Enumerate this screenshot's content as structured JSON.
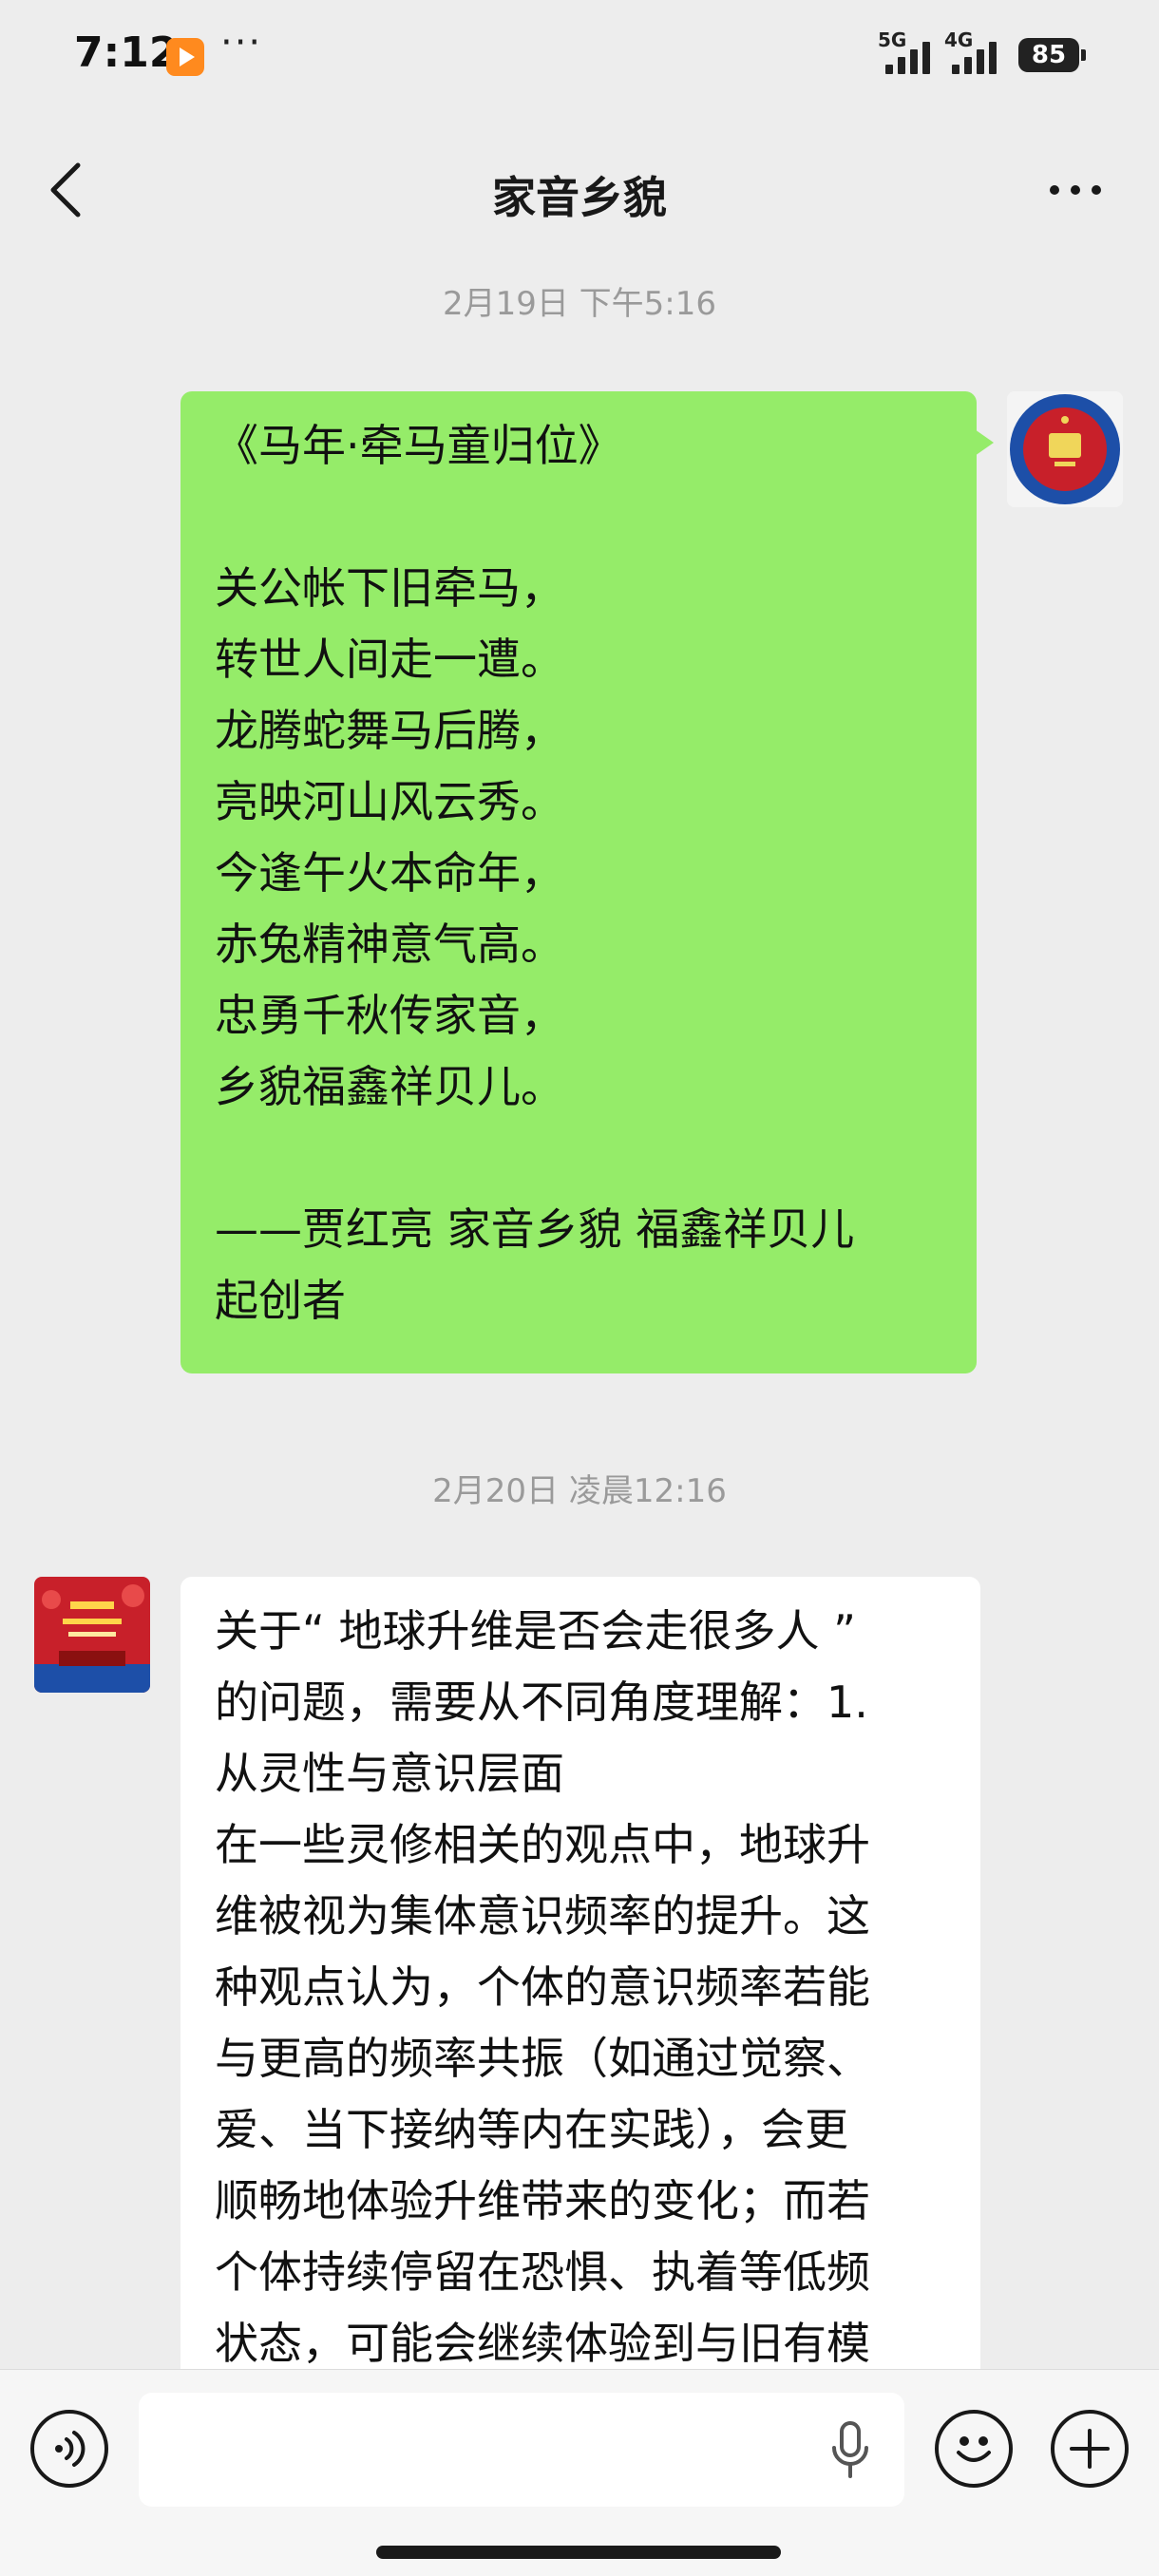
{
  "status_bar": {
    "time": "7:12",
    "more_dots": "···",
    "signal_1_label": "5G",
    "signal_2_label": "4G",
    "battery": "85",
    "app_badge_icon": "video-app-icon"
  },
  "nav": {
    "title": "家音乡貌",
    "back_icon": "chevron-left-icon",
    "more_icon": "more-horizontal-icon"
  },
  "messages": [
    {
      "timestamp": "2月19日 下午5:16",
      "sender": "me",
      "text": "《马年·牵马童归位》\n\n关公帐下旧牵马，\n转世人间走一遭。\n龙腾蛇舞马后腾，\n亮映河山风云秀。\n今逢午火本命年，\n赤兔精神意气高。\n忠勇千秋传家音，\n乡貌福鑫祥贝儿。\n\n——贾红亮 家音乡貌 福鑫祥贝儿\n起创者"
    },
    {
      "timestamp": "2月20日 凌晨12:16",
      "sender": "other",
      "text": "关于“ 地球升维是否会走很多人 ”\n的问题，需要从不同角度理解：1.\n从灵性与意识层面\n在一些灵修相关的观点中，地球升\n维被视为集体意识频率的提升。这\n种观点认为，个体的意识频率若能\n与更高的频率共振（如通过觉察、\n爱、当下接纳等内在实践），会更\n顺畅地体验升维带来的变化；而若\n个体持续停留在恐惧、执着等低频\n状态，可能会继续体验到与旧有模"
    }
  ],
  "avatars": {
    "me_icon": "round-emblem-avatar",
    "other_icon": "red-poster-avatar"
  },
  "input_bar": {
    "voice_icon": "voice-mode-icon",
    "input_value": "",
    "mic_icon": "microphone-icon",
    "emoji_icon": "emoji-smile-icon",
    "plus_icon": "plus-icon"
  },
  "colors": {
    "background": "#ededed",
    "my_bubble": "#95ec69",
    "other_bubble": "#ffffff",
    "timestamp_text": "#9a9a9a",
    "avatar_red": "#c8202a",
    "avatar_blue": "#1d4fa8"
  }
}
